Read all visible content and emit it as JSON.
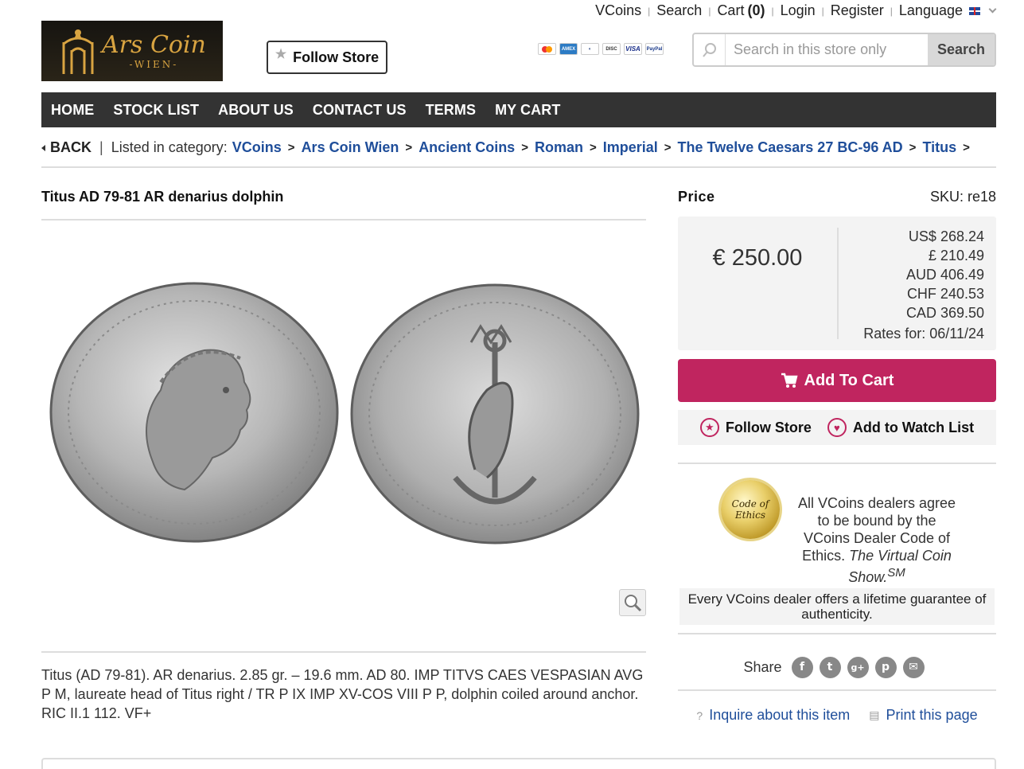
{
  "toplinks": {
    "vcoins": "VCoins",
    "search": "Search",
    "cart": "Cart",
    "cart_count": "(0)",
    "login": "Login",
    "register": "Register",
    "language": "Language"
  },
  "logo": {
    "title": "Ars Coin",
    "subtitle": "-WIEN-"
  },
  "follow_store_top": "Follow Store",
  "payment_cards": [
    "mastercard-icon",
    "amex-icon",
    "diners-icon",
    "discover-icon",
    "visa-icon",
    "paypal-icon"
  ],
  "search_box": {
    "placeholder": "Search in this store only",
    "button": "Search"
  },
  "nav": [
    "HOME",
    "STOCK LIST",
    "ABOUT US",
    "CONTACT US",
    "TERMS",
    "MY CART"
  ],
  "breadcrumb": {
    "back": "BACK",
    "listed": "Listed in category:",
    "items": [
      "VCoins",
      "Ars Coin Wien",
      "Ancient Coins",
      "Roman",
      "Imperial",
      "The Twelve Caesars 27 BC-96 AD",
      "Titus"
    ]
  },
  "item": {
    "title": "Titus AD 79-81 AR denarius dolphin",
    "description": "Titus (AD 79-81). AR denarius. 2.85 gr. – 19.6 mm. AD 80. IMP TITVS CAES VESPASIAN AVG P M, laureate head of Titus right / TR P IX IMP XV-COS VIII P P, dolphin coiled around anchor. RIC II.1 112. VF+"
  },
  "price": {
    "label": "Price",
    "sku": "SKU: re18",
    "main": "€ 250.00",
    "conversions": [
      "US$ 268.24",
      "£ 210.49",
      "AUD 406.49",
      "CHF 240.53",
      "CAD 369.50"
    ],
    "rates": "Rates for: 06/11/24"
  },
  "actions": {
    "add_to_cart": "Add To Cart",
    "follow_store": "Follow Store",
    "watch_list": "Add to Watch List"
  },
  "ethics": {
    "seal_line1": "Code of",
    "seal_line2": "Ethics",
    "text_plain": "All VCoins dealers agree to be bound by the VCoins Dealer Code of Ethics.",
    "text_italic": "The Virtual Coin Show.",
    "text_sup": "SM",
    "guarantee": "Every VCoins dealer offers a lifetime guarantee of authenticity."
  },
  "share": {
    "label": "Share",
    "icons": [
      "f",
      "t",
      "g+",
      "p",
      "✉"
    ]
  },
  "bottom_links": {
    "inquire": "Inquire about this item",
    "print": "Print this page"
  },
  "colors": {
    "nav_bg": "#333333",
    "accent": "#c0255f",
    "link": "#1f4e9a",
    "panel_bg": "#f3f3f3"
  }
}
